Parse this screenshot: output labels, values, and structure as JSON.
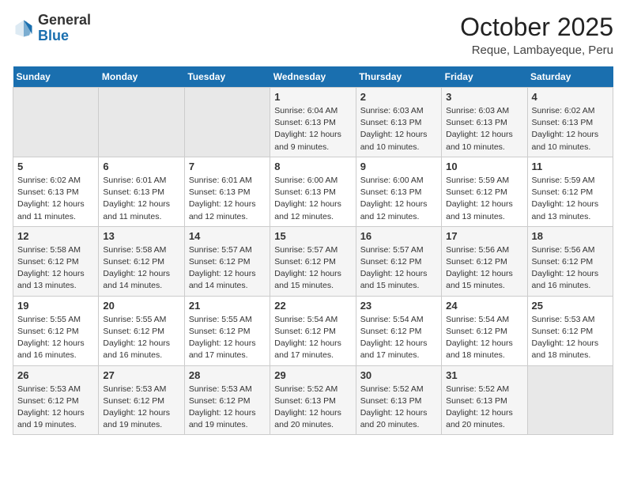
{
  "header": {
    "logo_general": "General",
    "logo_blue": "Blue",
    "month_title": "October 2025",
    "location": "Reque, Lambayeque, Peru"
  },
  "days_of_week": [
    "Sunday",
    "Monday",
    "Tuesday",
    "Wednesday",
    "Thursday",
    "Friday",
    "Saturday"
  ],
  "weeks": [
    [
      {
        "day": "",
        "sunrise": "",
        "sunset": "",
        "daylight": "",
        "empty": true
      },
      {
        "day": "",
        "sunrise": "",
        "sunset": "",
        "daylight": "",
        "empty": true
      },
      {
        "day": "",
        "sunrise": "",
        "sunset": "",
        "daylight": "",
        "empty": true
      },
      {
        "day": "1",
        "sunrise": "Sunrise: 6:04 AM",
        "sunset": "Sunset: 6:13 PM",
        "daylight": "Daylight: 12 hours and 9 minutes."
      },
      {
        "day": "2",
        "sunrise": "Sunrise: 6:03 AM",
        "sunset": "Sunset: 6:13 PM",
        "daylight": "Daylight: 12 hours and 10 minutes."
      },
      {
        "day": "3",
        "sunrise": "Sunrise: 6:03 AM",
        "sunset": "Sunset: 6:13 PM",
        "daylight": "Daylight: 12 hours and 10 minutes."
      },
      {
        "day": "4",
        "sunrise": "Sunrise: 6:02 AM",
        "sunset": "Sunset: 6:13 PM",
        "daylight": "Daylight: 12 hours and 10 minutes."
      }
    ],
    [
      {
        "day": "5",
        "sunrise": "Sunrise: 6:02 AM",
        "sunset": "Sunset: 6:13 PM",
        "daylight": "Daylight: 12 hours and 11 minutes."
      },
      {
        "day": "6",
        "sunrise": "Sunrise: 6:01 AM",
        "sunset": "Sunset: 6:13 PM",
        "daylight": "Daylight: 12 hours and 11 minutes."
      },
      {
        "day": "7",
        "sunrise": "Sunrise: 6:01 AM",
        "sunset": "Sunset: 6:13 PM",
        "daylight": "Daylight: 12 hours and 12 minutes."
      },
      {
        "day": "8",
        "sunrise": "Sunrise: 6:00 AM",
        "sunset": "Sunset: 6:13 PM",
        "daylight": "Daylight: 12 hours and 12 minutes."
      },
      {
        "day": "9",
        "sunrise": "Sunrise: 6:00 AM",
        "sunset": "Sunset: 6:13 PM",
        "daylight": "Daylight: 12 hours and 12 minutes."
      },
      {
        "day": "10",
        "sunrise": "Sunrise: 5:59 AM",
        "sunset": "Sunset: 6:12 PM",
        "daylight": "Daylight: 12 hours and 13 minutes."
      },
      {
        "day": "11",
        "sunrise": "Sunrise: 5:59 AM",
        "sunset": "Sunset: 6:12 PM",
        "daylight": "Daylight: 12 hours and 13 minutes."
      }
    ],
    [
      {
        "day": "12",
        "sunrise": "Sunrise: 5:58 AM",
        "sunset": "Sunset: 6:12 PM",
        "daylight": "Daylight: 12 hours and 13 minutes."
      },
      {
        "day": "13",
        "sunrise": "Sunrise: 5:58 AM",
        "sunset": "Sunset: 6:12 PM",
        "daylight": "Daylight: 12 hours and 14 minutes."
      },
      {
        "day": "14",
        "sunrise": "Sunrise: 5:57 AM",
        "sunset": "Sunset: 6:12 PM",
        "daylight": "Daylight: 12 hours and 14 minutes."
      },
      {
        "day": "15",
        "sunrise": "Sunrise: 5:57 AM",
        "sunset": "Sunset: 6:12 PM",
        "daylight": "Daylight: 12 hours and 15 minutes."
      },
      {
        "day": "16",
        "sunrise": "Sunrise: 5:57 AM",
        "sunset": "Sunset: 6:12 PM",
        "daylight": "Daylight: 12 hours and 15 minutes."
      },
      {
        "day": "17",
        "sunrise": "Sunrise: 5:56 AM",
        "sunset": "Sunset: 6:12 PM",
        "daylight": "Daylight: 12 hours and 15 minutes."
      },
      {
        "day": "18",
        "sunrise": "Sunrise: 5:56 AM",
        "sunset": "Sunset: 6:12 PM",
        "daylight": "Daylight: 12 hours and 16 minutes."
      }
    ],
    [
      {
        "day": "19",
        "sunrise": "Sunrise: 5:55 AM",
        "sunset": "Sunset: 6:12 PM",
        "daylight": "Daylight: 12 hours and 16 minutes."
      },
      {
        "day": "20",
        "sunrise": "Sunrise: 5:55 AM",
        "sunset": "Sunset: 6:12 PM",
        "daylight": "Daylight: 12 hours and 16 minutes."
      },
      {
        "day": "21",
        "sunrise": "Sunrise: 5:55 AM",
        "sunset": "Sunset: 6:12 PM",
        "daylight": "Daylight: 12 hours and 17 minutes."
      },
      {
        "day": "22",
        "sunrise": "Sunrise: 5:54 AM",
        "sunset": "Sunset: 6:12 PM",
        "daylight": "Daylight: 12 hours and 17 minutes."
      },
      {
        "day": "23",
        "sunrise": "Sunrise: 5:54 AM",
        "sunset": "Sunset: 6:12 PM",
        "daylight": "Daylight: 12 hours and 17 minutes."
      },
      {
        "day": "24",
        "sunrise": "Sunrise: 5:54 AM",
        "sunset": "Sunset: 6:12 PM",
        "daylight": "Daylight: 12 hours and 18 minutes."
      },
      {
        "day": "25",
        "sunrise": "Sunrise: 5:53 AM",
        "sunset": "Sunset: 6:12 PM",
        "daylight": "Daylight: 12 hours and 18 minutes."
      }
    ],
    [
      {
        "day": "26",
        "sunrise": "Sunrise: 5:53 AM",
        "sunset": "Sunset: 6:12 PM",
        "daylight": "Daylight: 12 hours and 19 minutes."
      },
      {
        "day": "27",
        "sunrise": "Sunrise: 5:53 AM",
        "sunset": "Sunset: 6:12 PM",
        "daylight": "Daylight: 12 hours and 19 minutes."
      },
      {
        "day": "28",
        "sunrise": "Sunrise: 5:53 AM",
        "sunset": "Sunset: 6:12 PM",
        "daylight": "Daylight: 12 hours and 19 minutes."
      },
      {
        "day": "29",
        "sunrise": "Sunrise: 5:52 AM",
        "sunset": "Sunset: 6:13 PM",
        "daylight": "Daylight: 12 hours and 20 minutes."
      },
      {
        "day": "30",
        "sunrise": "Sunrise: 5:52 AM",
        "sunset": "Sunset: 6:13 PM",
        "daylight": "Daylight: 12 hours and 20 minutes."
      },
      {
        "day": "31",
        "sunrise": "Sunrise: 5:52 AM",
        "sunset": "Sunset: 6:13 PM",
        "daylight": "Daylight: 12 hours and 20 minutes."
      },
      {
        "day": "",
        "sunrise": "",
        "sunset": "",
        "daylight": "",
        "empty": true
      }
    ]
  ]
}
